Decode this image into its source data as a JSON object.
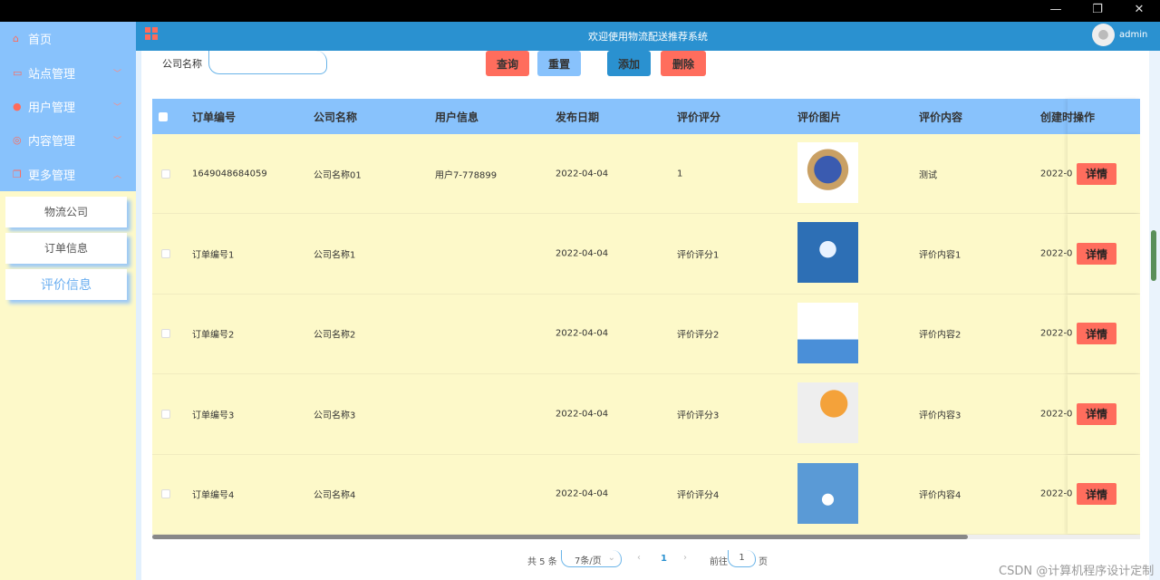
{
  "header": {
    "title": "欢迎使用物流配送推荐系统",
    "user": "admin"
  },
  "sidebar": {
    "items": [
      {
        "label": "首页",
        "icon": "home-icon"
      },
      {
        "label": "站点管理",
        "icon": "monitor-icon"
      },
      {
        "label": "用户管理",
        "icon": "user-icon"
      },
      {
        "label": "内容管理",
        "icon": "chat-icon"
      },
      {
        "label": "更多管理",
        "icon": "copy-icon"
      }
    ],
    "sub_items": [
      "物流公司",
      "订单信息",
      "评价信息"
    ]
  },
  "search": {
    "label": "公司名称",
    "value": "",
    "placeholder": ""
  },
  "toolbar": {
    "query": "查询",
    "reset": "重置",
    "add": "添加",
    "delete": "删除"
  },
  "colors": {
    "header": "#2a91d0",
    "menu": "#88c2fc",
    "row": "#fdf9c9",
    "danger": "#ff6d5d"
  },
  "table": {
    "headers": [
      "订单编号",
      "公司名称",
      "用户信息",
      "发布日期",
      "评价评分",
      "评价图片",
      "评价内容",
      "创建时",
      "操作"
    ],
    "rows": [
      {
        "order": "1649048684059",
        "company": "公司名称01",
        "user": "用户7-778899",
        "date": "2022-04-04",
        "score": "1",
        "content": "测试",
        "created": "2022-0",
        "action": "详情"
      },
      {
        "order": "订单编号1",
        "company": "公司名称1",
        "user": "",
        "date": "2022-04-04",
        "score": "评价评分1",
        "content": "评价内容1",
        "created": "2022-0",
        "action": "详情"
      },
      {
        "order": "订单编号2",
        "company": "公司名称2",
        "user": "",
        "date": "2022-04-04",
        "score": "评价评分2",
        "content": "评价内容2",
        "created": "2022-0",
        "action": "详情"
      },
      {
        "order": "订单编号3",
        "company": "公司名称3",
        "user": "",
        "date": "2022-04-04",
        "score": "评价评分3",
        "content": "评价内容3",
        "created": "2022-0",
        "action": "详情"
      },
      {
        "order": "订单编号4",
        "company": "公司名称4",
        "user": "",
        "date": "2022-04-04",
        "score": "评价评分4",
        "content": "评价内容4",
        "created": "2022-0",
        "action": "详情"
      }
    ]
  },
  "pagination": {
    "total": "共 5 条",
    "page_size": "7条/页",
    "current": "1",
    "goto_label": "前往",
    "goto_value": "1",
    "page_suffix": "页"
  },
  "watermark": "CSDN @计算机程序设计定制"
}
